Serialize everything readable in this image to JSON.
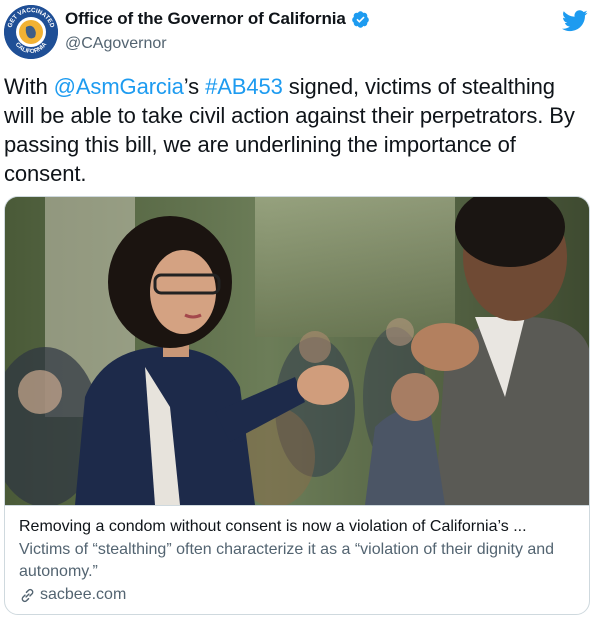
{
  "header": {
    "display_name": "Office of the Governor of California",
    "handle": "@CAgovernor",
    "avatar_text_top": "GET VACCINATED",
    "avatar_text_bottom": "CALIFORNIA",
    "verified_icon": "verified-badge-icon",
    "logo_icon": "twitter-bird-icon"
  },
  "tweet": {
    "part1": "With ",
    "mention": "@AsmGarcia",
    "part2": "’s ",
    "hashtag": "#AB453",
    "part3": " signed, victims of stealthing will be able to take civil action against their perpetrators. By passing this bill, we are underlining the importance of consent."
  },
  "card": {
    "image_alt": "photo",
    "title": "Removing a condom without consent is now a violation of California’s ...",
    "description": "Victims of “stealthing” often characterize it as a “violation of their dignity and autonomy.”",
    "domain": "sacbee.com",
    "domain_icon": "link-icon"
  },
  "colors": {
    "link": "#1d9bf0",
    "text": "#0f1419",
    "secondary": "#536471",
    "border": "#cfd9de",
    "avatar_blue": "#1f4f96",
    "avatar_gold": "#f2b233"
  }
}
